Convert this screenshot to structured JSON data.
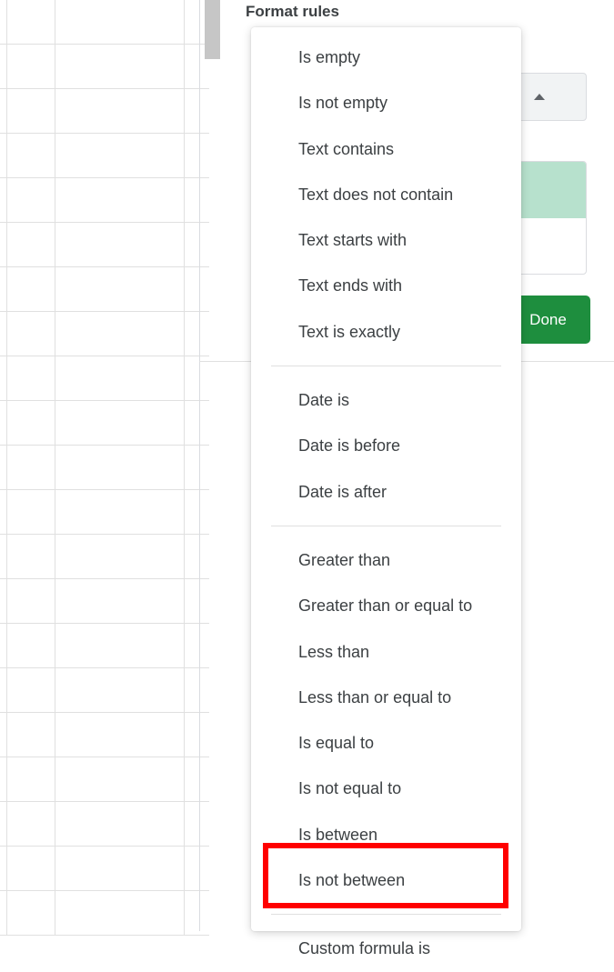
{
  "panel": {
    "section_label": "Format rules",
    "done_label": "Done"
  },
  "menu": {
    "group1": [
      "Is empty",
      "Is not empty",
      "Text contains",
      "Text does not contain",
      "Text starts with",
      "Text ends with",
      "Text is exactly"
    ],
    "group2": [
      "Date is",
      "Date is before",
      "Date is after"
    ],
    "group3": [
      "Greater than",
      "Greater than or equal to",
      "Less than",
      "Less than or equal to",
      "Is equal to",
      "Is not equal to",
      "Is between",
      "Is not between"
    ],
    "group4": [
      "Custom formula is"
    ]
  }
}
